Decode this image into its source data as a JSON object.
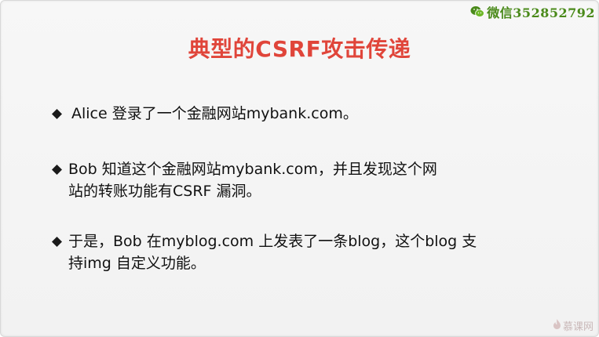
{
  "watermark": {
    "icon": "wechat-icon",
    "text": "微信352852792",
    "color": "#4a8a1a"
  },
  "slide": {
    "title": "典型的CSRF攻击传递",
    "title_color": "#e0453a",
    "bullets": [
      {
        "marker": "diamond-bullet-icon",
        "text": " Alice 登录了一个金融网站mybank.com。"
      },
      {
        "marker": "diamond-bullet-icon",
        "text": "Bob 知道这个金融网站mybank.com，并且发现这个网\n站的转账功能有CSRF 漏洞。"
      },
      {
        "marker": "diamond-bullet-icon",
        "text": "于是，Bob 在myblog.com 上发表了一条blog，这个blog 支\n持img 自定义功能。"
      }
    ]
  },
  "logo": {
    "icon": "mooc-flame-icon",
    "text": "慕课网"
  }
}
